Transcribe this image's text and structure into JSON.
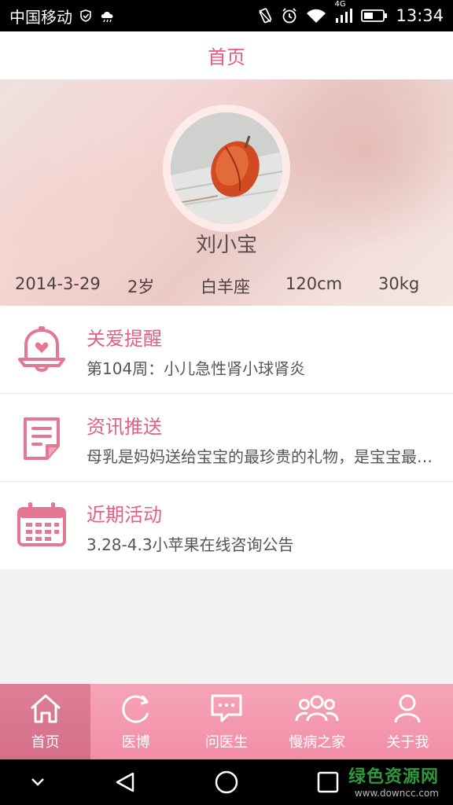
{
  "status_bar": {
    "carrier": "中国移动",
    "network": "4G",
    "time": "13:34"
  },
  "header": {
    "title": "首页"
  },
  "profile": {
    "name": "刘小宝",
    "birthday": "2014-3-29",
    "age": "2岁",
    "zodiac": "白羊座",
    "height": "120cm",
    "weight": "30kg"
  },
  "list": [
    {
      "icon": "bell-heart-icon",
      "title": "关爱提醒",
      "desc": "第104周：小儿急性肾小球肾炎"
    },
    {
      "icon": "document-icon",
      "title": "资讯推送",
      "desc": "母乳是妈妈送给宝宝的最珍贵的礼物，是宝宝最好的食物"
    },
    {
      "icon": "calendar-icon",
      "title": "近期活动",
      "desc": "3.28-4.3小苹果在线咨询公告"
    }
  ],
  "bottom_nav": [
    {
      "icon": "home-icon",
      "label": "首页",
      "active": true
    },
    {
      "icon": "refresh-icon",
      "label": "医博",
      "active": false
    },
    {
      "icon": "chat-icon",
      "label": "问医生",
      "active": false
    },
    {
      "icon": "group-icon",
      "label": "慢病之家",
      "active": false
    },
    {
      "icon": "user-icon",
      "label": "关于我",
      "active": false
    }
  ],
  "watermark": {
    "main": "绿色资源网",
    "sub": "www.downcc.com"
  },
  "colors": {
    "accent": "#e25f86",
    "nav_bg": "#f28ea8",
    "nav_active": "#d66f8a"
  }
}
